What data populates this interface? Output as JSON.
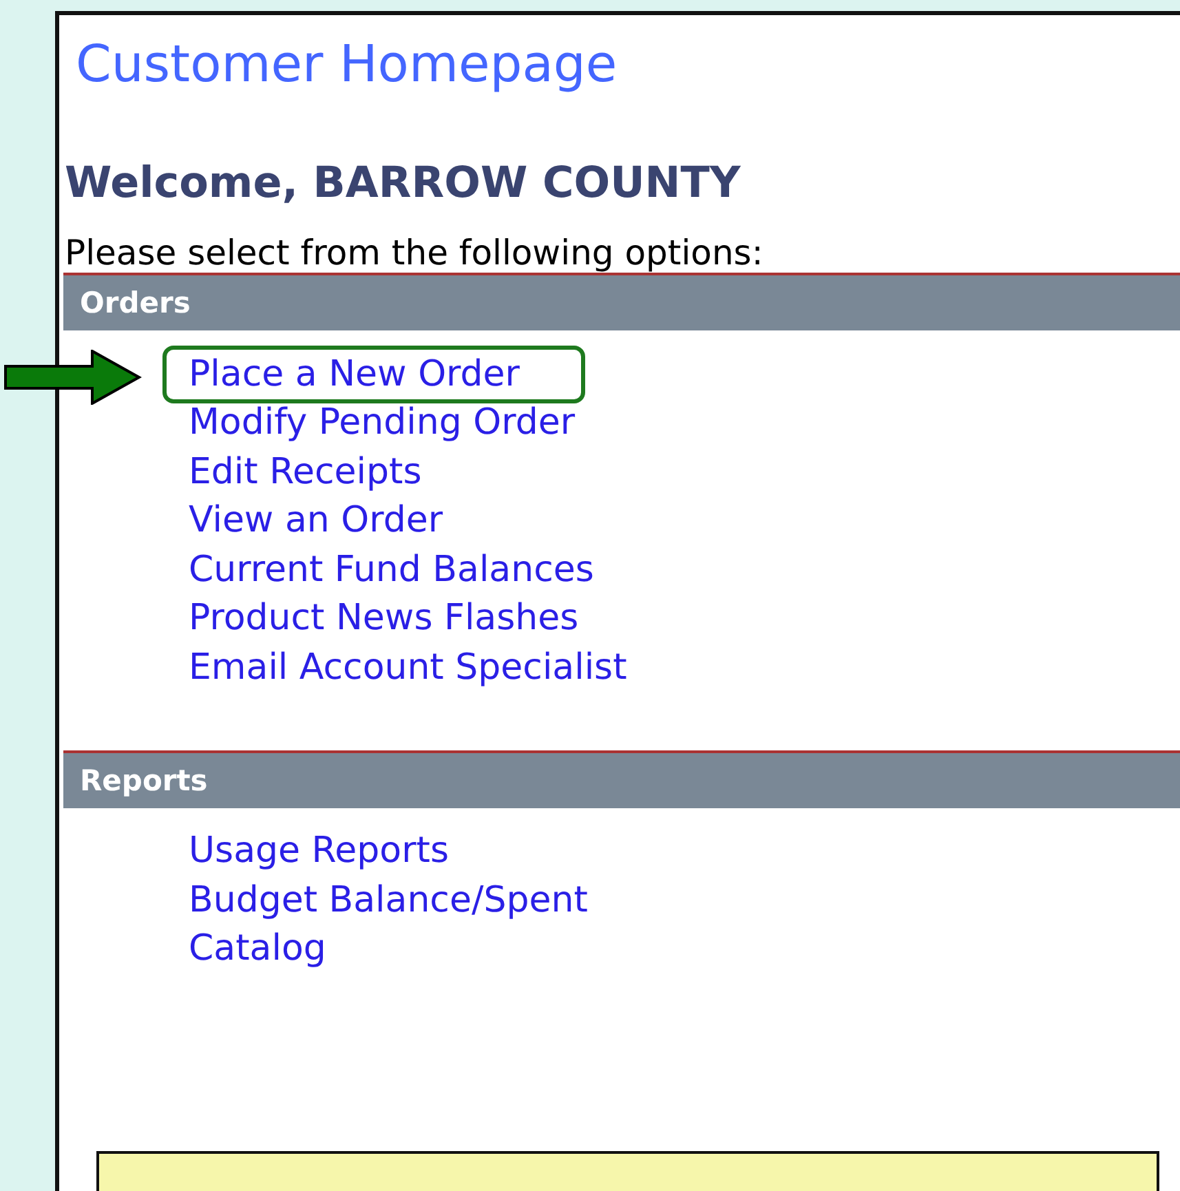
{
  "page": {
    "title": "Customer Homepage",
    "welcome": "Welcome, BARROW COUNTY",
    "instructions": "Please select from the following options:"
  },
  "sections": [
    {
      "heading": "Orders",
      "links": [
        {
          "label": "Place a New Order",
          "highlighted": true
        },
        {
          "label": "Modify Pending Order",
          "highlighted": false
        },
        {
          "label": "Edit Receipts",
          "highlighted": false
        },
        {
          "label": "View an Order",
          "highlighted": false
        },
        {
          "label": "Current Fund Balances",
          "highlighted": false
        },
        {
          "label": "Product News Flashes",
          "highlighted": false
        },
        {
          "label": "Email Account Specialist",
          "highlighted": false
        }
      ]
    },
    {
      "heading": "Reports",
      "links": [
        {
          "label": "Usage Reports",
          "highlighted": false
        },
        {
          "label": "Budget Balance/Spent",
          "highlighted": false
        },
        {
          "label": "Catalog",
          "highlighted": false
        }
      ]
    }
  ],
  "callout": {
    "kind": "note"
  }
}
